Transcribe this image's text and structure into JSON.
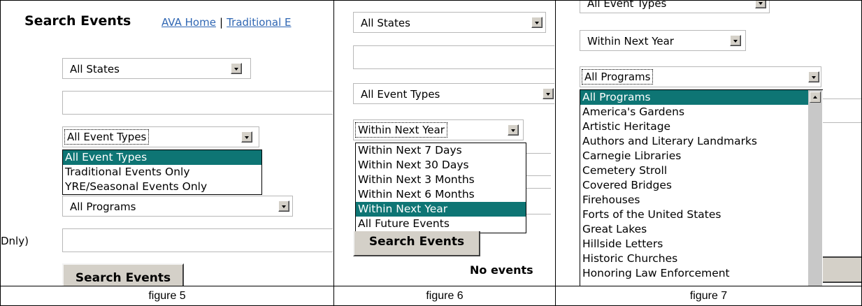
{
  "captions": [
    "figure 5",
    "figure 6",
    "figure 7"
  ],
  "figure5": {
    "title": "Search Events",
    "nav_link_home": "AVA Home",
    "nav_separator": "|",
    "nav_link_traditional": "Traditional E",
    "state_select": "All States",
    "event_type_select": "All Event Types",
    "event_type_options": [
      "All Event Types",
      "Traditional Events Only",
      "YRE/Seasonal Events Only"
    ],
    "event_type_selected_index": 0,
    "program_select": "All Programs",
    "side_label": "Dnly)",
    "search_button": "Search Events"
  },
  "figure6": {
    "state_select": "All States",
    "event_type_select": "All Event Types",
    "time_select": "Within Next Year",
    "time_options": [
      "Within Next 7 Days",
      "Within Next 30 Days",
      "Within Next 3 Months",
      "Within Next 6 Months",
      "Within Next Year",
      "All Future Events"
    ],
    "time_selected_index": 4,
    "search_button": "Search Events",
    "no_events_text": "No events"
  },
  "figure7": {
    "event_type_select": "All Event Types",
    "time_select": "Within Next Year",
    "program_select": "All Programs",
    "program_options": [
      "All Programs",
      "America's Gardens",
      "Artistic Heritage",
      "Authors and Literary Landmarks",
      "Carnegie Libraries",
      "Cemetery Stroll",
      "Covered Bridges",
      "Firehouses",
      "Forts of the United States",
      "Great Lakes",
      "Hillside Letters",
      "Historic Churches",
      "Honoring Law Enforcement"
    ],
    "program_selected_index": 0
  },
  "colors": {
    "selection": "#0e7574",
    "link": "#2f66b3",
    "button_face": "#d4d0c8"
  }
}
